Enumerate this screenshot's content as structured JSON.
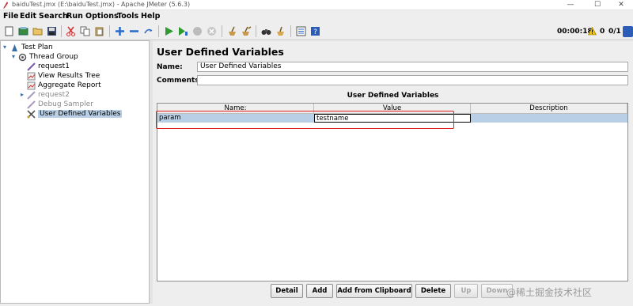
{
  "window": {
    "title": "baiduTest.jmx (E:\\baiduTest.jmx) - Apache JMeter (5.6.3)",
    "controls": [
      "—",
      "☐",
      "✕"
    ]
  },
  "menu": [
    "File",
    "Edit",
    "Search",
    "Run",
    "Options",
    "Tools",
    "Help"
  ],
  "toolbar": {
    "icons": [
      "new-icon",
      "templates-icon",
      "open-icon",
      "save-icon",
      "cut-icon",
      "copy-icon",
      "paste-icon",
      "expand-icon",
      "collapse-icon",
      "toggle-icon",
      "start-icon",
      "start-no-pauses-icon",
      "stop-icon",
      "shutdown-icon",
      "clear-icon",
      "clear-all-icon",
      "search-icon",
      "reset-search-icon",
      "function-helper-icon",
      "help-icon"
    ],
    "timer": "00:00:18",
    "warnings": "0",
    "threads": "0/1"
  },
  "tree": {
    "nodes": [
      {
        "label": "Test Plan",
        "icon": "test-plan-icon",
        "enabled": true
      },
      {
        "label": "Thread Group",
        "icon": "thread-group-icon",
        "enabled": true
      },
      {
        "label": "request1",
        "icon": "sampler-icon",
        "enabled": true
      },
      {
        "label": "View Results Tree",
        "icon": "listener-icon",
        "enabled": true
      },
      {
        "label": "Aggregate Report",
        "icon": "listener-icon",
        "enabled": true
      },
      {
        "label": "request2",
        "icon": "sampler-icon",
        "enabled": false
      },
      {
        "label": "Debug Sampler",
        "icon": "sampler-icon",
        "enabled": false
      },
      {
        "label": "User Defined Variables",
        "icon": "config-element-icon",
        "enabled": true,
        "selected": true
      }
    ]
  },
  "panel": {
    "title": "User Defined Variables",
    "name_label": "Name:",
    "name_value": "User Defined Variables",
    "comments_label": "Comments:",
    "comments_value": "",
    "section_title": "User Defined Variables",
    "columns": [
      "Name:",
      "Value",
      "Description"
    ],
    "rows": [
      {
        "name": "param",
        "value": "testname",
        "description": ""
      }
    ],
    "buttons": {
      "detail": "Detail",
      "add": "Add",
      "add_clipboard": "Add from Clipboard",
      "delete": "Delete",
      "up": "Up",
      "down": "Down"
    }
  },
  "watermark": "@稀土掘金技术社区",
  "colors": {
    "selection": "#b8cfe5",
    "highlight_box": "#e02020",
    "start_green": "#2f9a2f"
  }
}
